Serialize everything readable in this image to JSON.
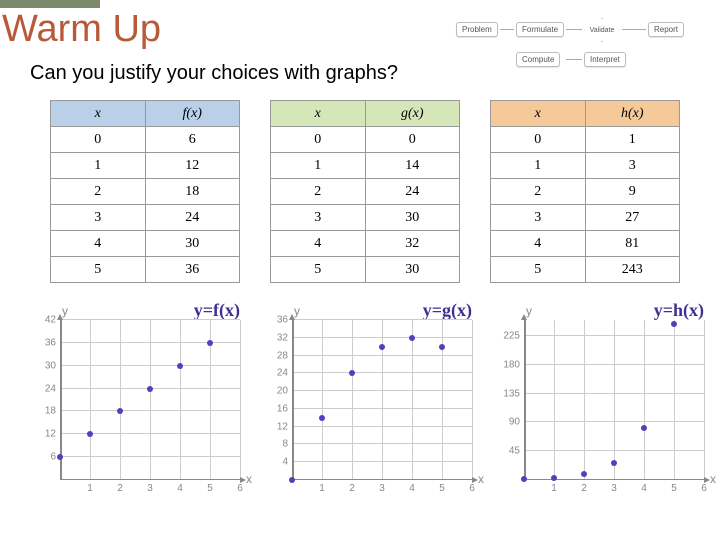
{
  "title": "Warm Up",
  "subtitle": "Can you justify your choices with graphs?",
  "flowchart": {
    "nodes": [
      "Problem",
      "Formulate",
      "Validate",
      "Report",
      "Compute",
      "Interpret"
    ]
  },
  "tables": {
    "f": {
      "header_x": "x",
      "header_y": "f(x)",
      "rows": [
        [
          0,
          6
        ],
        [
          1,
          12
        ],
        [
          2,
          18
        ],
        [
          3,
          24
        ],
        [
          4,
          30
        ],
        [
          5,
          36
        ]
      ]
    },
    "g": {
      "header_x": "x",
      "header_y": "g(x)",
      "rows": [
        [
          0,
          0
        ],
        [
          1,
          14
        ],
        [
          2,
          24
        ],
        [
          3,
          30
        ],
        [
          4,
          32
        ],
        [
          5,
          30
        ]
      ]
    },
    "h": {
      "header_x": "x",
      "header_y": "h(x)",
      "rows": [
        [
          0,
          1
        ],
        [
          1,
          3
        ],
        [
          2,
          9
        ],
        [
          3,
          27
        ],
        [
          4,
          81
        ],
        [
          5,
          243
        ]
      ]
    }
  },
  "chart_data": [
    {
      "type": "scatter",
      "title": "y=f(x)",
      "x": [
        0,
        1,
        2,
        3,
        4,
        5
      ],
      "y": [
        6,
        12,
        18,
        24,
        30,
        36
      ],
      "xlabel": "x",
      "ylabel": "y",
      "xlim": [
        0,
        6
      ],
      "ylim": [
        0,
        42
      ],
      "xticks": [
        1,
        2,
        3,
        4,
        5,
        6
      ],
      "yticks": [
        6,
        12,
        18,
        24,
        30,
        36,
        42
      ]
    },
    {
      "type": "scatter",
      "title": "y=g(x)",
      "x": [
        0,
        1,
        2,
        3,
        4,
        5
      ],
      "y": [
        0,
        14,
        24,
        30,
        32,
        30
      ],
      "xlabel": "x",
      "ylabel": "y",
      "xlim": [
        0,
        6
      ],
      "ylim": [
        0,
        36
      ],
      "xticks": [
        1,
        2,
        3,
        4,
        5,
        6
      ],
      "yticks": [
        4,
        8,
        12,
        16,
        20,
        24,
        28,
        32,
        36
      ]
    },
    {
      "type": "scatter",
      "title": "y=h(x)",
      "x": [
        0,
        1,
        2,
        3,
        4,
        5
      ],
      "y": [
        1,
        3,
        9,
        27,
        81,
        243
      ],
      "xlabel": "x",
      "ylabel": "y",
      "xlim": [
        0,
        6
      ],
      "ylim": [
        0,
        250
      ],
      "xticks": [
        1,
        2,
        3,
        4,
        5,
        6
      ],
      "yticks": [
        45,
        90,
        135,
        180,
        225
      ]
    }
  ]
}
